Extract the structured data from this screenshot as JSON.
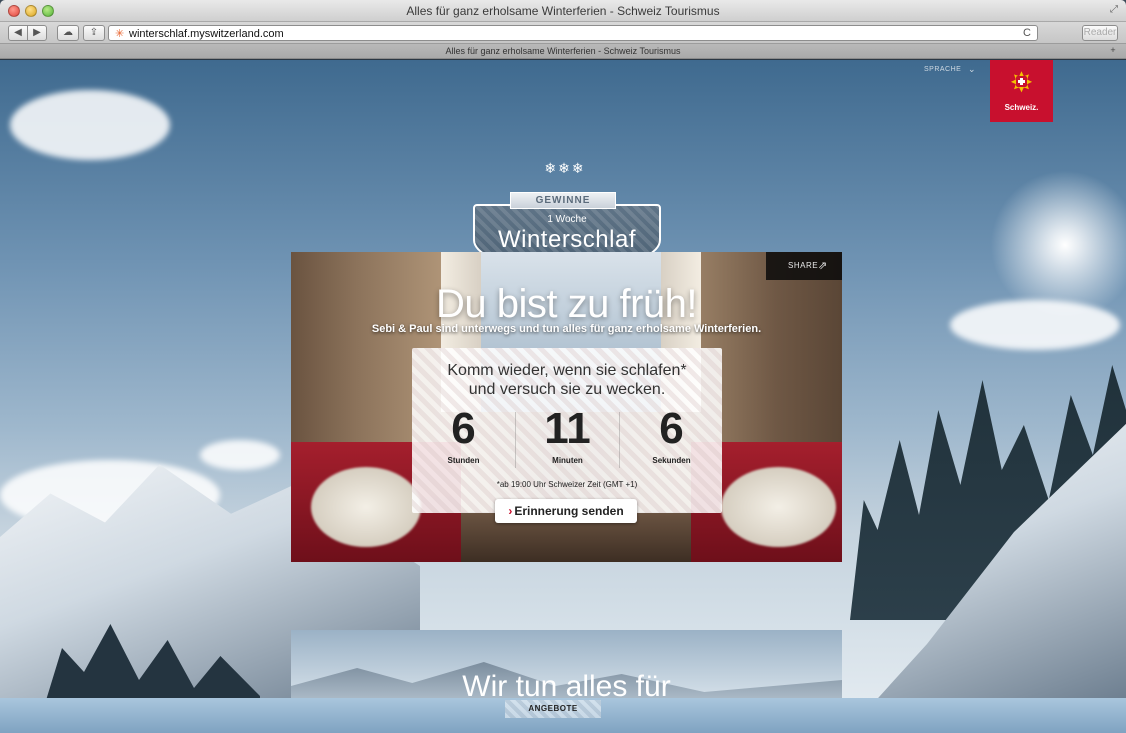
{
  "window": {
    "title": "Alles für ganz erholsame Winterferien - Schweiz Tourismus"
  },
  "toolbar": {
    "url": "winterschlaf.myswitzerland.com",
    "reader_label": "Reader"
  },
  "tab": {
    "title": "Alles für ganz erholsame Winterferien - Schweiz Tourismus"
  },
  "header": {
    "language_label": "SPRACHE",
    "logo_text": "Schweiz."
  },
  "badge": {
    "top": "GEWINNE",
    "week": "1 Woche",
    "title": "Winterschlaf"
  },
  "panel": {
    "share_label": "SHARE",
    "headline": "Du bist zu früh!",
    "subline": "Sebi & Paul sind unterwegs und tun alles für ganz erholsame Winterferien.",
    "card": {
      "line1": "Komm wieder, wenn sie schlafen*",
      "line2": "und versuch sie zu wecken.",
      "countdown": [
        {
          "value": "6",
          "label": "Stunden"
        },
        {
          "value": "11",
          "label": "Minuten"
        },
        {
          "value": "6",
          "label": "Sekunden"
        }
      ],
      "note": "*ab 19:00 Uhr Schweizer Zeit (GMT +1)"
    },
    "reminder_button": "Erinnerung senden"
  },
  "lower": {
    "headline": "Wir tun alles für"
  },
  "footer": {
    "offers_label": "ANGEBOTE"
  },
  "colors": {
    "brand_red": "#c8102e",
    "logo_yellow": "#f5c400"
  },
  "icons": [
    "back-icon",
    "forward-icon",
    "icloud-icon",
    "share-icon",
    "reload-icon",
    "snowflake-icon",
    "chevron-down-icon",
    "switzerland-logo-icon"
  ]
}
